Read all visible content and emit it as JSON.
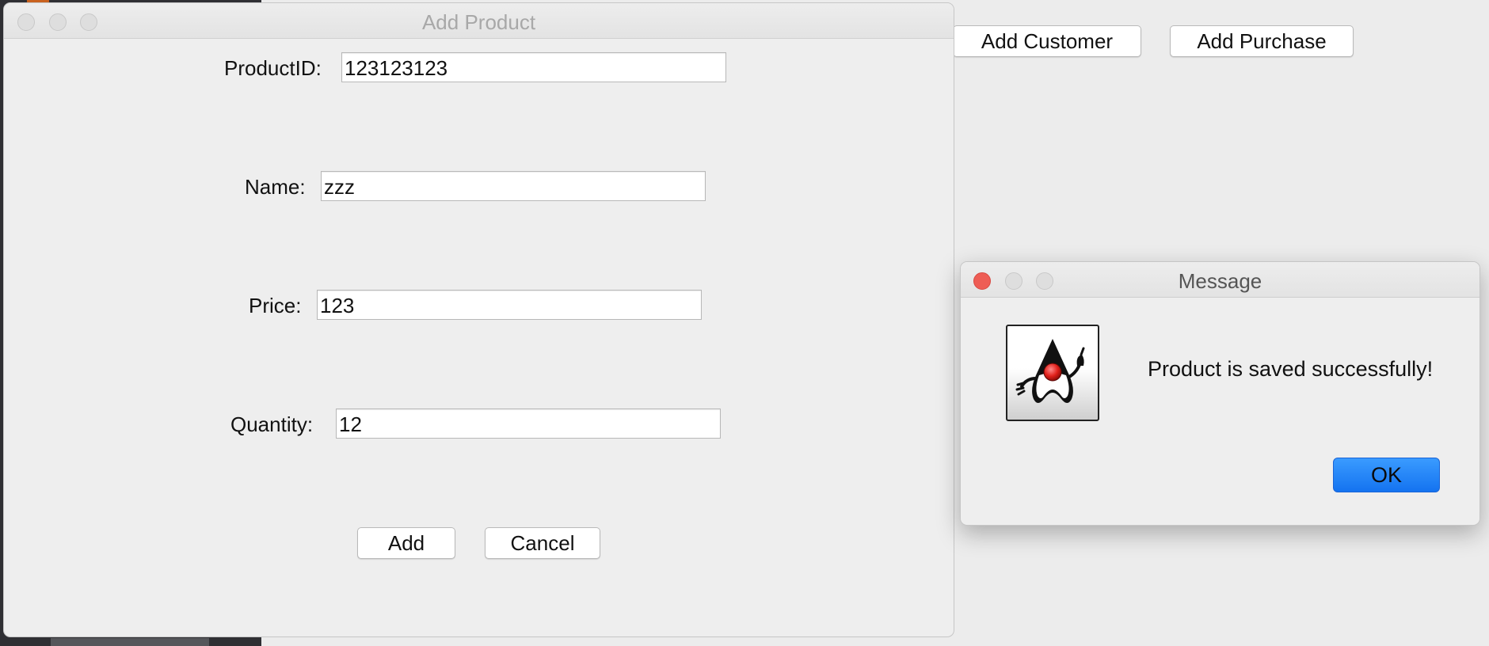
{
  "main_window": {
    "title_fragment": "",
    "add_customer_label": "Add Customer",
    "add_purchase_label": "Add Purchase"
  },
  "add_product_dialog": {
    "title": "Add Product",
    "fields": {
      "product_id": {
        "label": "ProductID:",
        "value": "123123123"
      },
      "name": {
        "label": "Name:",
        "value": "zzz"
      },
      "price": {
        "label": "Price:",
        "value": "123"
      },
      "quantity": {
        "label": "Quantity:",
        "value": "12"
      }
    },
    "add_label": "Add",
    "cancel_label": "Cancel"
  },
  "message_dialog": {
    "title": "Message",
    "icon": "java-duke-icon",
    "text": "Product is saved successfully!",
    "ok_label": "OK"
  },
  "colors": {
    "window_bg": "#eeeeee",
    "close_red": "#ee5d55",
    "ok_blue": "#1473f0",
    "desktop_dark": "#2f2f33"
  }
}
